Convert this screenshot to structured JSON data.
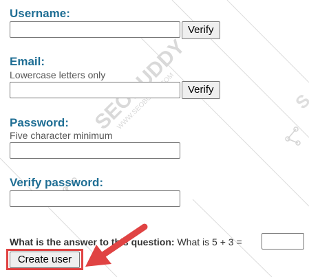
{
  "form": {
    "username": {
      "label": "Username:",
      "value": "",
      "verify_label": "Verify"
    },
    "email": {
      "label": "Email:",
      "hint": "Lowercase letters only",
      "value": "",
      "verify_label": "Verify"
    },
    "password": {
      "label": "Password:",
      "hint": "Five character minimum",
      "value": ""
    },
    "verify_password": {
      "label": "Verify password:",
      "value": ""
    },
    "captcha": {
      "question_label": "What is the answer to this question:",
      "question_text": "What is 5 + 3 =",
      "value": ""
    },
    "submit_label": "Create user"
  },
  "annotation": {
    "highlight_color": "#e04343",
    "arrow_icon": "red-arrow-icon"
  },
  "watermark": {
    "brand": "SEOBUDDY",
    "url": "WWW.SEOBUDDY.COM",
    "color": "#d9d9d9"
  },
  "colors": {
    "label": "#1f6e94",
    "hint": "#555555"
  }
}
